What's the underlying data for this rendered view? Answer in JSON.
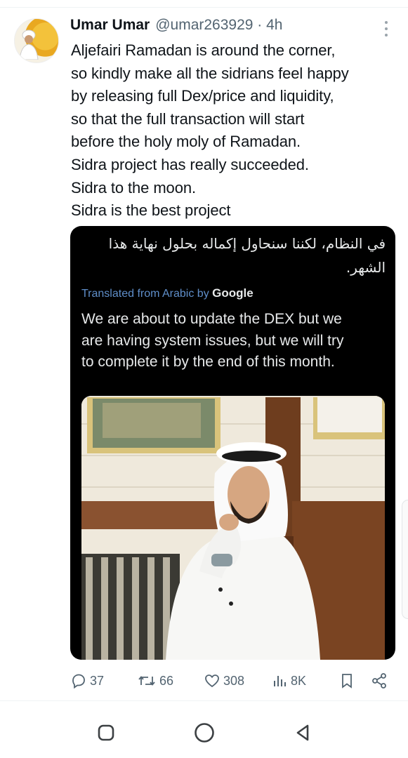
{
  "tweet": {
    "author_name": "Umar Umar",
    "handle_time": "@umar263929 · 4h",
    "text_lines": [
      "Aljefairi Ramadan is around the corner,",
      "so kindly make all the sidrians feel happy",
      "by releasing full Dex/price and liquidity,",
      "so that the full transaction will start",
      "before the holy moly of Ramadan.",
      "Sidra project has really succeeded.",
      "Sidra to the moon.",
      "Sidra is the best project"
    ]
  },
  "media": {
    "arabic_lines": [
      "في النظام، لكننا سنحاول إكماله بحلول نهاية هذا",
      "الشهر."
    ],
    "translated_from": "Translated from Arabic by",
    "translator": "Google",
    "translation_lines": [
      "We are about to update the DEX but we",
      "are having system issues, but we will try",
      "to complete it by the end of this month."
    ]
  },
  "actions": {
    "replies": "37",
    "reposts": "66",
    "likes": "308",
    "views": "8K"
  },
  "icons": {
    "reply": "reply-icon",
    "repost": "repost-icon",
    "like": "heart-icon",
    "views": "views-icon",
    "bookmark": "bookmark-icon",
    "share": "share-icon",
    "more": "more-vertical-icon"
  },
  "colors": {
    "text": "#0f1419",
    "secondary": "#536471",
    "link": "#5f8ec9",
    "media_bg": "#000000"
  }
}
